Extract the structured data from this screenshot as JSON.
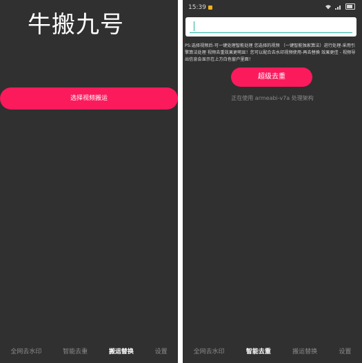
{
  "left": {
    "title": "牛搬九号",
    "select_button": "选择视频搬运",
    "nav": [
      "全网去水印",
      "智能去重",
      "搬运替换",
      "设置"
    ],
    "active_nav": 2
  },
  "right": {
    "status": {
      "time": "15:39"
    },
    "input": {
      "value": "",
      "placeholder": ""
    },
    "ps_text": "PS:选择视频后-可一键处理智能处理 您选择的视频 （一键智能独家算法）进行处理-采用引擎算法处理 视频去重效果更明显！您可以配合去水印视频使用-再去替换 效果更佳 - 视频导出信息会显示在上方白色窗户里面！",
    "super_button": "超级去重",
    "arch_text": "正在使用 armeabi-v7a 处理架构",
    "nav": [
      "全网去水印",
      "智能去重",
      "搬运替换",
      "设置"
    ],
    "active_nav": 1
  },
  "colors": {
    "accent": "#fb1a5c",
    "background": "#303030",
    "input_underline": "#23b3a2"
  }
}
